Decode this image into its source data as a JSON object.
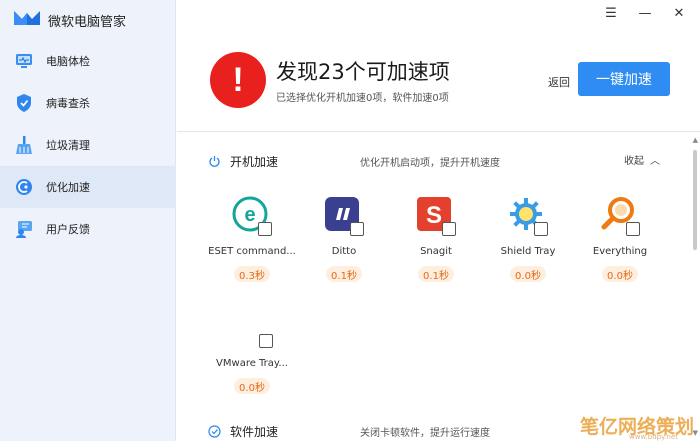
{
  "app": {
    "title": "微软电脑管家",
    "accent": "#2f8cf2"
  },
  "window": {
    "menu_glyph": "☰",
    "minimize_glyph": "—",
    "close_glyph": "✕"
  },
  "sidebar": {
    "items": [
      {
        "label": "电脑体检",
        "icon": "monitor-icon"
      },
      {
        "label": "病毒查杀",
        "icon": "shield-icon"
      },
      {
        "label": "垃圾清理",
        "icon": "broom-icon"
      },
      {
        "label": "优化加速",
        "icon": "rocket-icon",
        "active": true
      },
      {
        "label": "用户反馈",
        "icon": "feedback-icon"
      }
    ]
  },
  "header": {
    "title": "发现23个可加速项",
    "subtitle": "已选择优化开机加速0项，软件加速0项",
    "back_label": "返回",
    "action_label": "一键加速",
    "alert_color": "#e8211e"
  },
  "sections": [
    {
      "title": "开机加速",
      "desc": "优化开机启动项，提升开机速度",
      "collapse_label": "收起",
      "apps": [
        {
          "name": "ESET command...",
          "time": "0.3秒",
          "icon": "eset-icon",
          "checked": false
        },
        {
          "name": "Ditto",
          "time": "0.1秒",
          "icon": "ditto-icon",
          "checked": false
        },
        {
          "name": "Snagit",
          "time": "0.1秒",
          "icon": "snagit-icon",
          "checked": false
        },
        {
          "name": "Shield Tray",
          "time": "0.0秒",
          "icon": "gear-icon",
          "checked": false
        },
        {
          "name": "Everything",
          "time": "0.0秒",
          "icon": "magnifier-icon",
          "checked": false
        },
        {
          "name": "VMware Tray...",
          "time": "0.0秒",
          "icon": "vmware-icon",
          "checked": false
        }
      ]
    },
    {
      "title": "软件加速",
      "desc": "关闭卡顿软件，提升运行速度"
    }
  ],
  "watermark": {
    "text": "笔亿网络策划",
    "sub": "www.bdpy.net"
  }
}
